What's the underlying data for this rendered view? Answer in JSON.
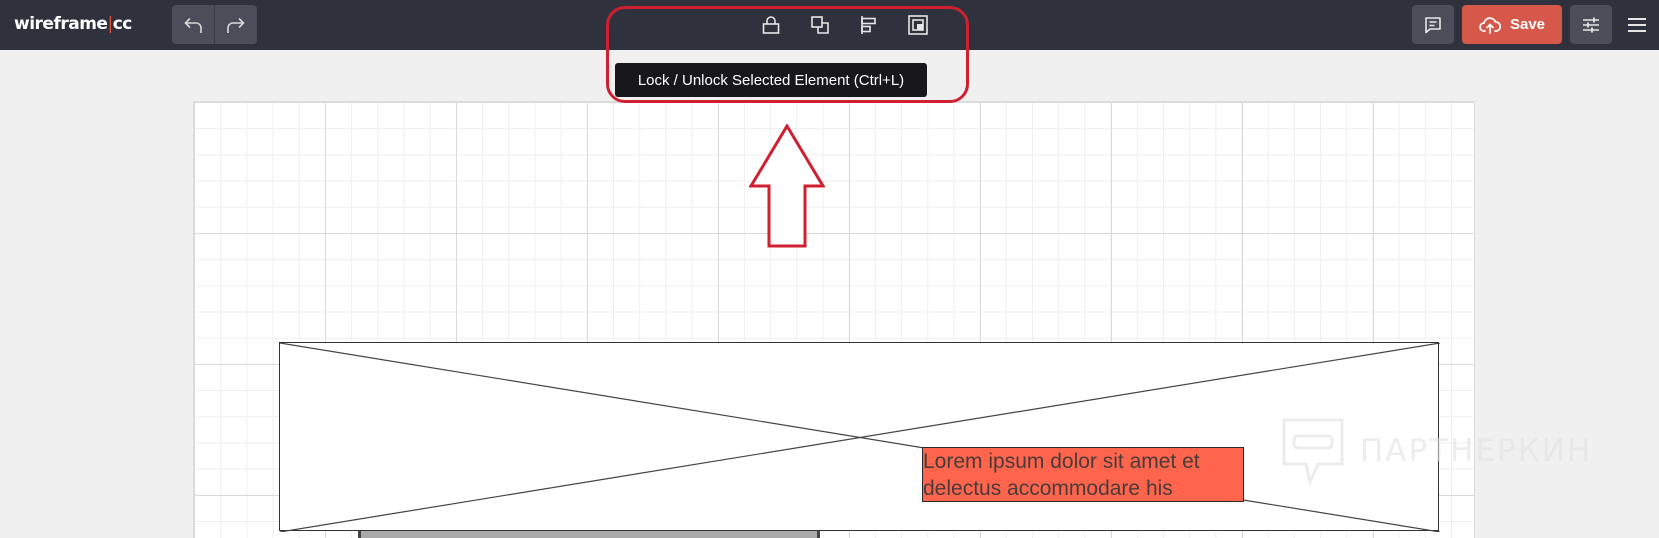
{
  "app": {
    "logo_left": "wireframe",
    "logo_sep": "|",
    "logo_right": "cc"
  },
  "toolbar": {
    "undo_icon": "undo-icon",
    "redo_icon": "redo-icon",
    "tools": [
      "lock-icon",
      "duplicate-icon",
      "align-icon",
      "group-icon"
    ],
    "save_label": "Save",
    "save_icon": "cloud-upload-icon",
    "comment_icon": "comment-icon",
    "settings_icon": "sliders-icon",
    "menu_icon": "hamburger-icon"
  },
  "tooltip": {
    "text": "Lock / Unlock Selected Element (Ctrl+L)"
  },
  "canvas": {
    "text_element": "Lorem ipsum dolor sit amet et delectus accommodare his"
  },
  "watermark": {
    "text": "ПАРТНЕРКИН"
  },
  "colors": {
    "topbar": "#2f323d",
    "save": "#d6584a",
    "annotation": "#d0202f",
    "text_element_bg": "#ff654d"
  }
}
